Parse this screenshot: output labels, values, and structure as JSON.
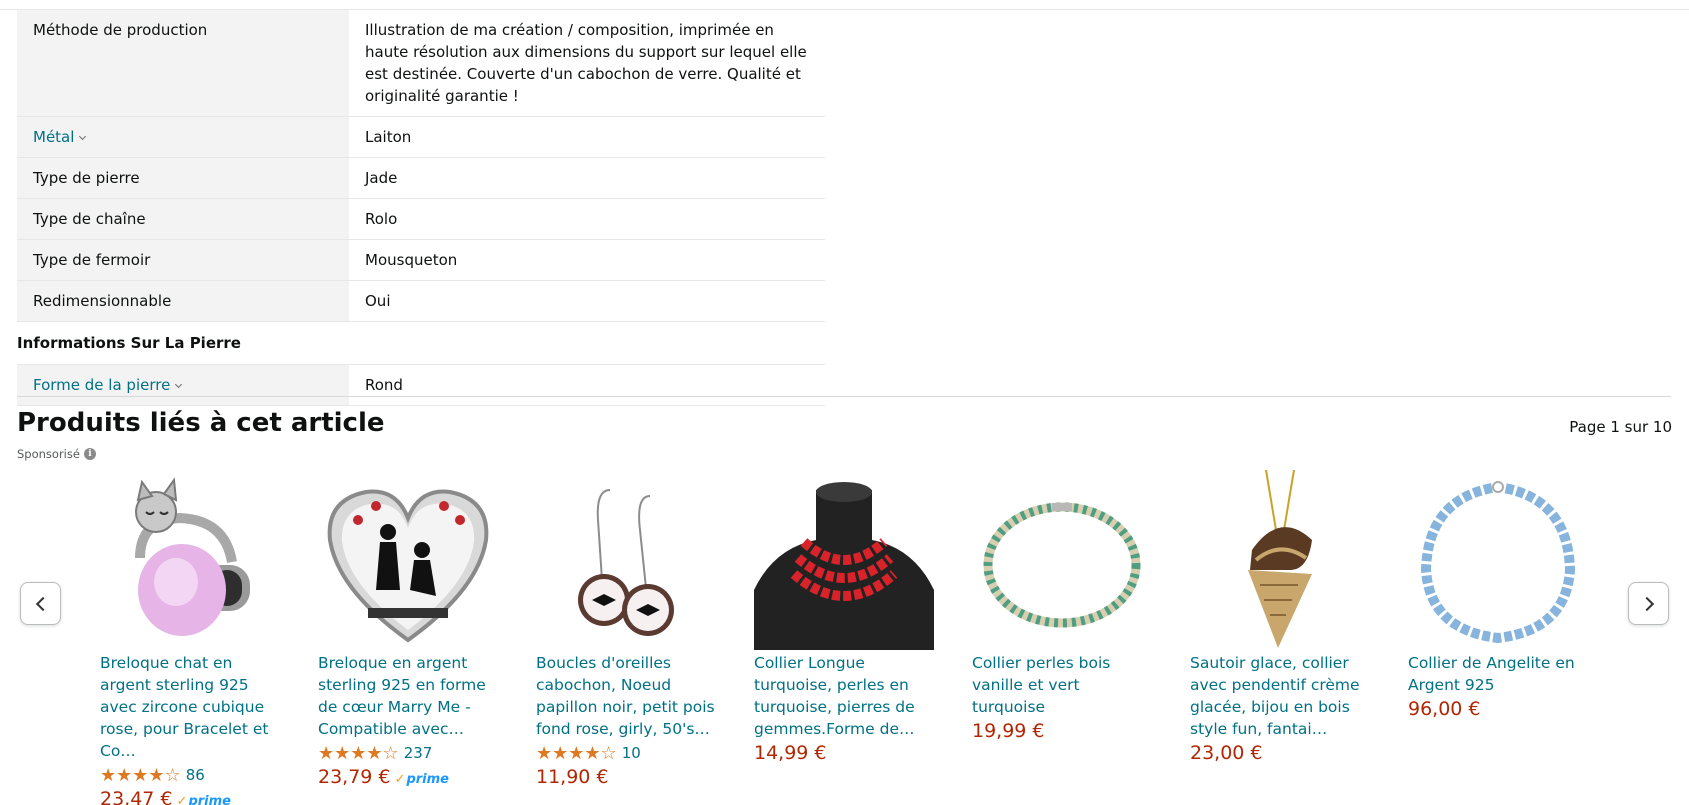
{
  "spec_rows": [
    {
      "key": "Méthode de production",
      "value": "Illustration de ma création / composition, imprimée en haute résolution aux dimensions du support sur lequel elle est destinée. Couverte d'un cabochon de verre. Qualité et originalité garantie !",
      "link": false
    },
    {
      "key": "Métal",
      "value": "Laiton",
      "link": true
    },
    {
      "key": "Type de pierre",
      "value": "Jade",
      "link": false
    },
    {
      "key": "Type de chaîne",
      "value": "Rolo",
      "link": false
    },
    {
      "key": "Type de fermoir",
      "value": "Mousqueton",
      "link": false
    },
    {
      "key": "Redimensionnable",
      "value": "Oui",
      "link": false
    }
  ],
  "stone_section": {
    "heading": "Informations Sur La Pierre",
    "row": {
      "key": "Forme de la pierre",
      "value": "Rond"
    }
  },
  "related": {
    "title": "Produits liés à cet article",
    "sponsored": "Sponsorisé",
    "page_indicator": "Page 1 sur 10",
    "products": [
      {
        "title": "Breloque chat en argent sterling 925 avec zircone cubique rose, pour Bracelet et Co…",
        "stars": "★★★★☆",
        "reviews": "86",
        "price": "23,47 €",
        "prime": "prime",
        "image": "cat-charm"
      },
      {
        "title": "Breloque en argent sterling 925 en forme de cœur Marry Me - Compatible avec…",
        "stars": "★★★★☆",
        "reviews": "237",
        "price": "23,79 €",
        "prime": "prime",
        "image": "heart-charm"
      },
      {
        "title": "Boucles d'oreilles cabochon, Noeud papillon noir, petit pois fond rose, girly, 50's…",
        "stars": "★★★★☆",
        "reviews": "10",
        "price": "11,90 €",
        "prime": "",
        "image": "earrings"
      },
      {
        "title": "Collier Longue turquoise, perles en turquoise, pierres de gemmes.Forme de…",
        "stars": "",
        "reviews": "",
        "price": "14,99 €",
        "prime": "",
        "image": "red-necklace"
      },
      {
        "title": "Collier perles bois vanille et vert turquoise",
        "stars": "",
        "reviews": "",
        "price": "19,99 €",
        "prime": "",
        "image": "bead-necklace"
      },
      {
        "title": "Sautoir glace, collier avec pendentif crème glacée, bijou en bois style fun, fantai…",
        "stars": "",
        "reviews": "",
        "price": "23,00 €",
        "prime": "",
        "image": "icecream-pendant"
      },
      {
        "title": "Collier de Angelite en Argent 925",
        "stars": "",
        "reviews": "",
        "price": "96,00 €",
        "prime": "",
        "image": "blue-necklace"
      }
    ]
  },
  "icons": {
    "prev": "chevron-left-icon",
    "next": "chevron-right-icon",
    "info": "info-icon"
  },
  "colors": {
    "link": "#007185",
    "price": "#b12704",
    "stars": "#de7921",
    "prime": "#1a98ff"
  }
}
